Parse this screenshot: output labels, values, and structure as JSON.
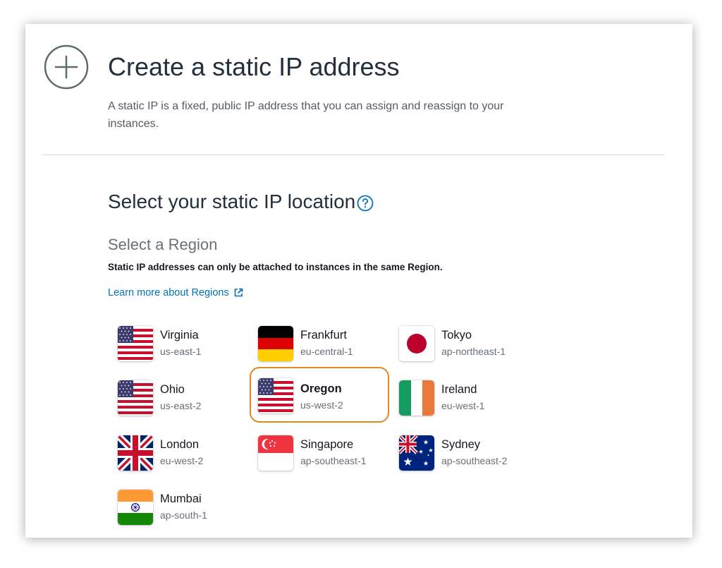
{
  "header": {
    "title": "Create a static IP address",
    "description": "A static IP is a fixed, public IP address that you can assign and reassign to your instances."
  },
  "location": {
    "section_title": "Select your static IP location",
    "region_heading": "Select a Region",
    "note": "Static IP addresses can only be attached to instances in the same Region.",
    "learn_more": "Learn more about Regions"
  },
  "colors": {
    "accent_link": "#0073bb",
    "selected_border": "#e08a24",
    "title_text": "#232f3e"
  },
  "regions": [
    {
      "name": "Virginia",
      "code": "us-east-1",
      "flag": "us-flag",
      "selected": false
    },
    {
      "name": "Frankfurt",
      "code": "eu-central-1",
      "flag": "germany-flag",
      "selected": false
    },
    {
      "name": "Tokyo",
      "code": "ap-northeast-1",
      "flag": "japan-flag",
      "selected": false
    },
    {
      "name": "Ohio",
      "code": "us-east-2",
      "flag": "us-flag",
      "selected": false
    },
    {
      "name": "Oregon",
      "code": "us-west-2",
      "flag": "us-flag",
      "selected": true
    },
    {
      "name": "Ireland",
      "code": "eu-west-1",
      "flag": "ireland-flag",
      "selected": false
    },
    {
      "name": "London",
      "code": "eu-west-2",
      "flag": "uk-flag",
      "selected": false
    },
    {
      "name": "Singapore",
      "code": "ap-southeast-1",
      "flag": "singapore-flag",
      "selected": false
    },
    {
      "name": "Sydney",
      "code": "ap-southeast-2",
      "flag": "australia-flag",
      "selected": false
    },
    {
      "name": "Mumbai",
      "code": "ap-south-1",
      "flag": "india-flag",
      "selected": false
    }
  ]
}
